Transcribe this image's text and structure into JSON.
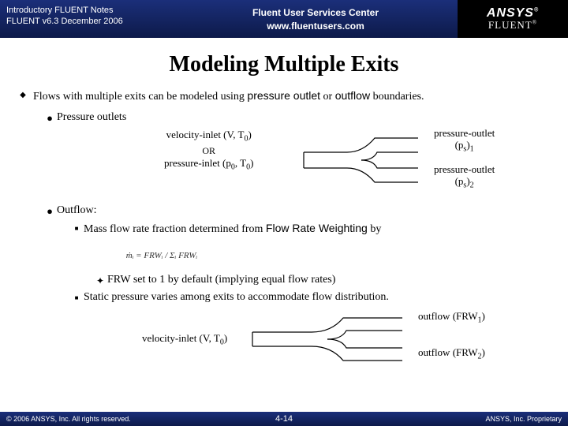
{
  "header": {
    "left_line1": "Introductory FLUENT Notes",
    "left_line2": "FLUENT v6.3 December 2006",
    "center_line1": "Fluent User Services Center",
    "center_line2": "www.fluentusers.com",
    "logo_top": "ANSYS",
    "logo_bottom": "FLUENT"
  },
  "title": "Modeling Multiple Exits",
  "intro": {
    "pre": "Flows with multiple exits can be modeled using ",
    "kw1": "pressure outlet",
    "mid": " or ",
    "kw2": "outflow",
    "post": " boundaries."
  },
  "b1": {
    "label": "Pressure outlets"
  },
  "d1": {
    "inlet_l1": "velocity-inlet (V, T",
    "inlet_l1_sub": "0",
    "inlet_l1_close": ")",
    "or": "OR",
    "inlet_l2": "pressure-inlet (p",
    "inlet_l2_sub1": "0",
    "inlet_l2_mid": ", T",
    "inlet_l2_sub2": "0",
    "inlet_l2_close": ")",
    "out1": "pressure-outlet",
    "out1_sym": "(p",
    "out1_sub": "s",
    "out1_close": ")",
    "out1_idx": "1",
    "out2": "pressure-outlet",
    "out2_sym": "(p",
    "out2_sub": "s",
    "out2_close": ")",
    "out2_idx": "2"
  },
  "b2": {
    "label": "Outflow:"
  },
  "b2a": {
    "pre": "Mass flow rate fraction determined from ",
    "kw": "Flow Rate Weighting",
    "post": " by"
  },
  "chart_data": {
    "type": "table",
    "title": "Mass flow rate fraction formula",
    "formula_tex": "\\dot m_i = \\dfrac{FRW_i}{\\sum_i FRW_i}",
    "formula_text": "ṁᵢ = FRWᵢ / Σᵢ FRWᵢ"
  },
  "b2a_i": "FRW set to 1 by default (implying equal flow rates)",
  "b2b": "Static pressure varies among exits to accommodate flow distribution.",
  "d2": {
    "inlet": "velocity-inlet (V, T",
    "inlet_sub": "0",
    "inlet_close": ")",
    "out1": "outflow (FRW",
    "out1_idx": "1",
    "out1_close": ")",
    "out2": "outflow (FRW",
    "out2_idx": "2",
    "out2_close": ")"
  },
  "footer": {
    "left": "© 2006 ANSYS, Inc. All rights reserved.",
    "center": "4-14",
    "right": "ANSYS, Inc. Proprietary"
  }
}
